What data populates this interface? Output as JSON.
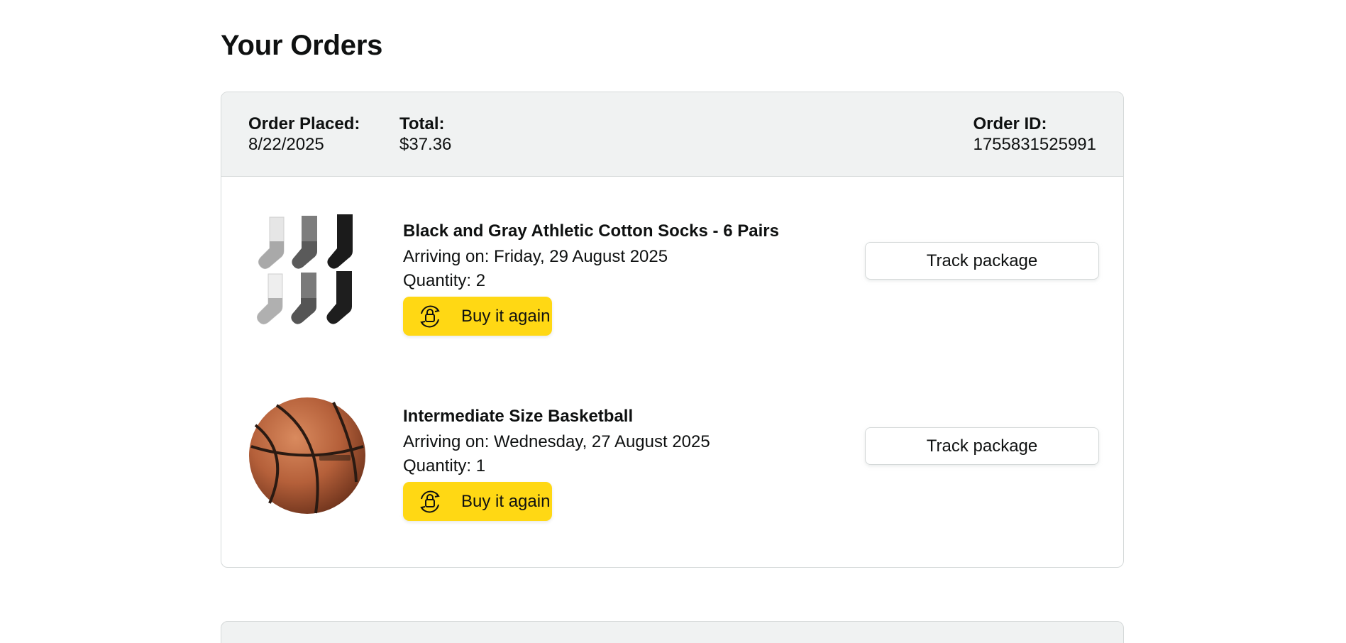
{
  "page": {
    "title": "Your Orders"
  },
  "order": {
    "placed_label": "Order Placed:",
    "placed_value": "8/22/2025",
    "total_label": "Total:",
    "total_value": "$37.36",
    "id_label": "Order ID:",
    "id_value": "1755831525991",
    "items": [
      {
        "name": "Black and Gray Athletic Cotton Socks - 6 Pairs",
        "arriving": "Arriving on: Friday, 29 August 2025",
        "quantity": "Quantity: 2",
        "buy_again_label": "Buy it again",
        "track_label": "Track package",
        "image_icon": "socks-image"
      },
      {
        "name": "Intermediate Size Basketball",
        "arriving": "Arriving on: Wednesday, 27 August 2025",
        "quantity": "Quantity: 1",
        "buy_again_label": "Buy it again",
        "track_label": "Track package",
        "image_icon": "basketball-image"
      }
    ]
  },
  "colors": {
    "buy_again_bg": "#ffd814",
    "header_bg": "#f0f2f2",
    "border": "#d5d9d9"
  }
}
